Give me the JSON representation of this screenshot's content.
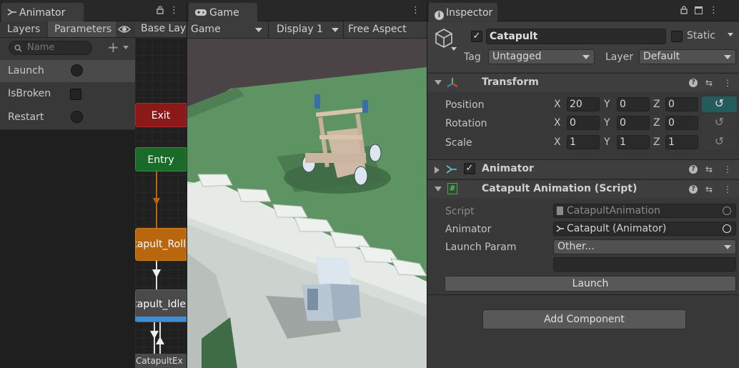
{
  "animator": {
    "tab_title": "Animator",
    "subtabs": {
      "layers": "Layers",
      "parameters": "Parameters"
    },
    "breadcrumb": "Base Lay",
    "search_placeholder": "Name",
    "parameters": [
      {
        "name": "Launch",
        "type": "trigger"
      },
      {
        "name": "IsBroken",
        "type": "bool"
      },
      {
        "name": "Restart",
        "type": "trigger"
      }
    ],
    "states": {
      "exit": "Exit",
      "entry": "Entry",
      "roll": "Catapult_Roll",
      "idle": "Catapult_Idle",
      "exit_state": "CatapultEx"
    },
    "colors": {
      "exit": "#8c1919",
      "entry": "#1a6b2a",
      "roll": "#b8670f",
      "idle": "#4a4a4a",
      "progress": "#3c8ed8"
    }
  },
  "game": {
    "tab_title": "Game",
    "display_mode": "Game",
    "display": "Display 1",
    "aspect": "Free Aspect"
  },
  "inspector": {
    "tab_title": "Inspector",
    "object_name": "Catapult",
    "static_label": "Static",
    "tag_label": "Tag",
    "tag_value": "Untagged",
    "layer_label": "Layer",
    "layer_value": "Default",
    "transform": {
      "title": "Transform",
      "rows": [
        {
          "label": "Position",
          "x": "20",
          "y": "0",
          "z": "0"
        },
        {
          "label": "Rotation",
          "x": "0",
          "y": "0",
          "z": "0"
        },
        {
          "label": "Scale",
          "x": "1",
          "y": "1",
          "z": "1"
        }
      ]
    },
    "animator_component": {
      "title": "Animator"
    },
    "script_component": {
      "title": "Catapult Animation (Script)",
      "script_label": "Script",
      "script_value": "CatapultAnimation",
      "animator_label": "Animator",
      "animator_value": "Catapult (Animator)",
      "launch_param_label": "Launch Param",
      "launch_param_value": "Other...",
      "launch_button": "Launch"
    },
    "add_component": "Add Component",
    "accent_color": "#245c5c"
  }
}
